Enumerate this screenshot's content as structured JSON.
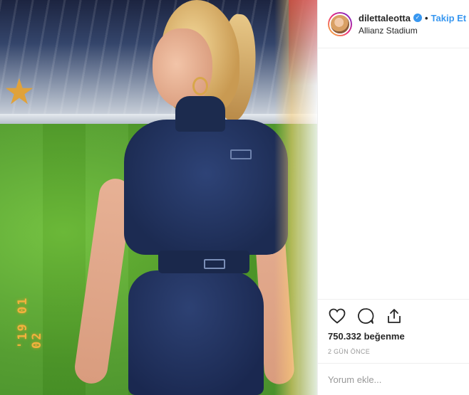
{
  "header": {
    "username": "dilettaleotta",
    "separator": "•",
    "follow_label": "Takip Et",
    "location": "Allianz Stadium"
  },
  "photo": {
    "date_stamp": "'19 01 02"
  },
  "actions": {
    "icons": [
      "heart-icon",
      "comment-icon",
      "share-icon"
    ],
    "likes": "750.332 beğenme",
    "time": "2 GÜN ÖNCE"
  },
  "comment": {
    "placeholder": "Yorum ekle..."
  },
  "colors": {
    "link_blue": "#3897f0",
    "text": "#262626",
    "muted": "#999999",
    "border": "#efefef"
  }
}
